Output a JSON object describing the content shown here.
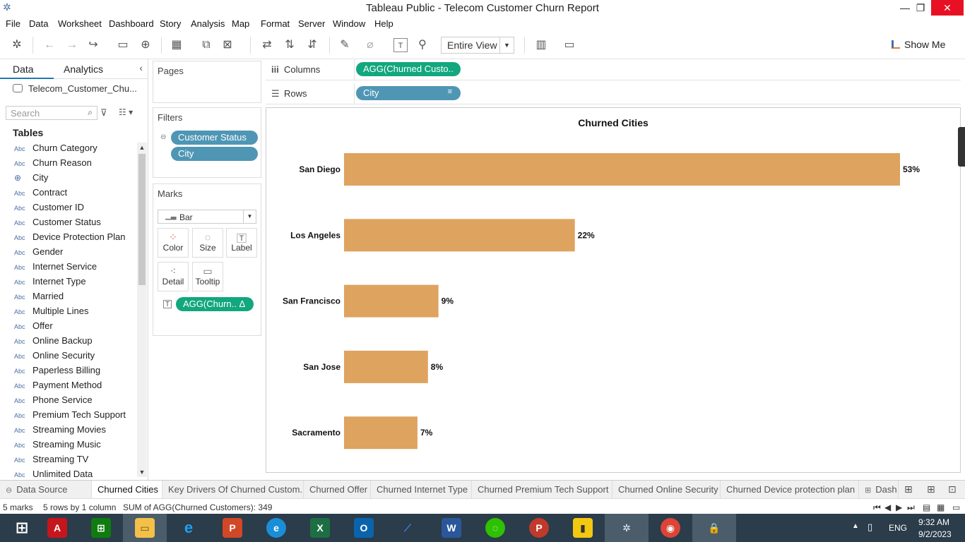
{
  "window": {
    "title": "Tableau Public - Telecom Customer Churn Report",
    "minimize": "—",
    "restore": "❐",
    "close": "✕"
  },
  "menu": [
    "File",
    "Data",
    "Worksheet",
    "Dashboard",
    "Story",
    "Analysis",
    "Map",
    "Format",
    "Server",
    "Window",
    "Help"
  ],
  "toolbar": {
    "view_mode": "Entire View",
    "show_me": "Show Me"
  },
  "left_pane": {
    "tab_data": "Data",
    "tab_analytics": "Analytics",
    "data_source": "Telecom_Customer_Chu...",
    "search_placeholder": "Search",
    "tables_heading": "Tables",
    "fields": [
      {
        "type": "Abc",
        "name": "Churn Category"
      },
      {
        "type": "Abc",
        "name": "Churn Reason"
      },
      {
        "type": "geo",
        "name": "City"
      },
      {
        "type": "Abc",
        "name": "Contract"
      },
      {
        "type": "Abc",
        "name": "Customer ID"
      },
      {
        "type": "Abc",
        "name": "Customer Status"
      },
      {
        "type": "Abc",
        "name": "Device Protection Plan"
      },
      {
        "type": "Abc",
        "name": "Gender"
      },
      {
        "type": "Abc",
        "name": "Internet Service"
      },
      {
        "type": "Abc",
        "name": "Internet Type"
      },
      {
        "type": "Abc",
        "name": "Married"
      },
      {
        "type": "Abc",
        "name": "Multiple Lines"
      },
      {
        "type": "Abc",
        "name": "Offer"
      },
      {
        "type": "Abc",
        "name": "Online Backup"
      },
      {
        "type": "Abc",
        "name": "Online Security"
      },
      {
        "type": "Abc",
        "name": "Paperless Billing"
      },
      {
        "type": "Abc",
        "name": "Payment Method"
      },
      {
        "type": "Abc",
        "name": "Phone Service"
      },
      {
        "type": "Abc",
        "name": "Premium Tech Support"
      },
      {
        "type": "Abc",
        "name": "Streaming Movies"
      },
      {
        "type": "Abc",
        "name": "Streaming Music"
      },
      {
        "type": "Abc",
        "name": "Streaming TV"
      },
      {
        "type": "Abc",
        "name": "Unlimited Data"
      }
    ]
  },
  "cards": {
    "pages": "Pages",
    "filters": "Filters",
    "filter_pills": [
      "Customer Status",
      "City"
    ],
    "marks": "Marks",
    "mark_type": "Bar",
    "mark_buttons": [
      "Color",
      "Size",
      "Label",
      "Detail",
      "Tooltip"
    ],
    "label_pill": "AGG(Churn..  Δ"
  },
  "shelves": {
    "columns_label": "Columns",
    "columns_pill": "AGG(Churned Custo..",
    "rows_label": "Rows",
    "rows_pill": "City"
  },
  "chart_data": {
    "type": "bar",
    "orientation": "horizontal",
    "title": "Churned Cities",
    "categories": [
      "San Diego",
      "Los Angeles",
      "San Francisco",
      "San Jose",
      "Sacramento"
    ],
    "values": [
      53,
      22,
      9,
      8,
      7
    ],
    "value_labels": [
      "53%",
      "22%",
      "9%",
      "8%",
      "7%"
    ],
    "bar_color": "#dea35f",
    "grid": false
  },
  "sheet_tabs": [
    "Data Source",
    "Churned Cities",
    "Key Drivers Of Churned Custom...",
    "Churned Offer",
    "Churned Internet Type",
    "Churned Premium Tech Support",
    "Churned Online Security",
    "Churned Device protection plan",
    "Dash"
  ],
  "status": {
    "marks": "5 marks",
    "rows": "5 rows by 1 column",
    "sum": "SUM of AGG(Churned Customers): 349"
  },
  "taskbar": {
    "lang": "ENG",
    "time": "9:32 AM",
    "date": "9/2/2023"
  }
}
